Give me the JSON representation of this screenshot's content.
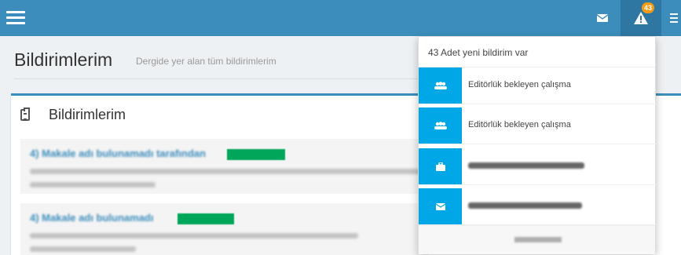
{
  "header": {
    "notification_count": "43"
  },
  "page": {
    "title": "Bildirimlerim",
    "subtitle": "Dergide yer alan tüm bildirimlerim"
  },
  "box": {
    "title": "Bildirimlerim"
  },
  "notifications_dropdown": {
    "header": "43 Adet yeni bildirim var",
    "items": [
      {
        "text": "Editörlük bekleyen çalışma",
        "icon": "users-icon"
      },
      {
        "text": "Editörlük bekleyen çalışma",
        "icon": "users-icon"
      },
      {
        "text": "",
        "icon": "briefcase-icon"
      },
      {
        "text": "",
        "icon": "envelope-icon"
      }
    ]
  },
  "colors": {
    "topbar": "#3c8dbc",
    "accent": "#00a7e6",
    "badge": "#f39c12",
    "tag": "#00a65a"
  }
}
